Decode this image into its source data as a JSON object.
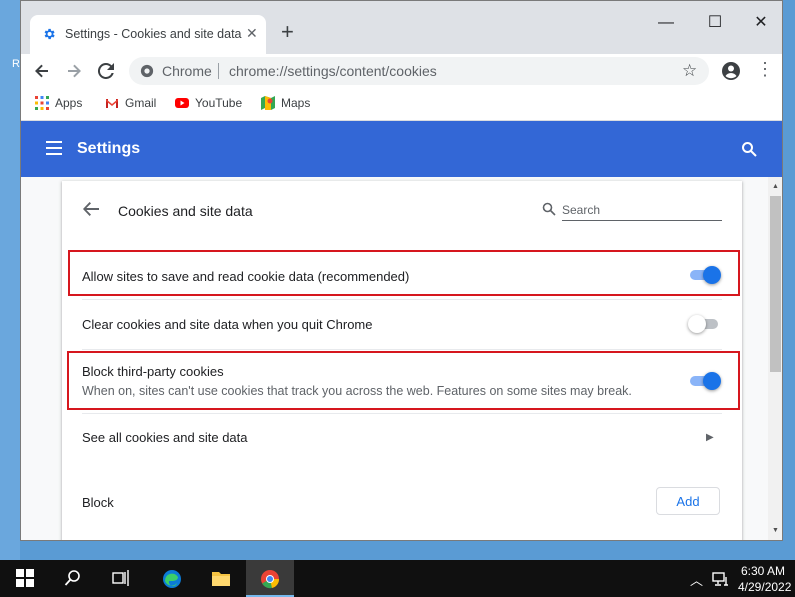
{
  "desktop": {
    "edge_letter": "R"
  },
  "browser": {
    "tab_title": "Settings - Cookies and site data",
    "tab_close": "✕",
    "new_tab": "+",
    "window_controls": {
      "minimize": "—",
      "maximize": "☐",
      "close": "✕"
    },
    "omnibox": {
      "scheme_label": "Chrome",
      "url": "chrome://settings/content/cookies"
    },
    "bookmarks": [
      {
        "label": "Apps",
        "icon": "apps-grid-icon"
      },
      {
        "label": "Gmail",
        "icon": "gmail-icon"
      },
      {
        "label": "YouTube",
        "icon": "youtube-icon"
      },
      {
        "label": "Maps",
        "icon": "maps-icon"
      }
    ]
  },
  "settings": {
    "header_title": "Settings",
    "page_title": "Cookies and site data",
    "search_placeholder": "Search",
    "rows": [
      {
        "label": "Allow sites to save and read cookie data (recommended)",
        "enabled": true,
        "highlighted": true
      },
      {
        "label": "Clear cookies and site data when you quit Chrome",
        "enabled": false,
        "highlighted": false
      },
      {
        "label": "Block third-party cookies",
        "sublabel": "When on, sites can't use cookies that track you across the web. Features on some sites may break.",
        "enabled": true,
        "highlighted": true
      },
      {
        "label": "See all cookies and site data"
      }
    ],
    "block_section": {
      "label": "Block",
      "add_button": "Add"
    },
    "colors": {
      "header": "#3367d6",
      "toggle_on": "#1a73e8",
      "highlight": "#d6171e"
    }
  },
  "taskbar": {
    "time": "6:30 AM",
    "date": "4/29/2022",
    "pinned": [
      "start-icon",
      "search-icon",
      "task-view-icon",
      "edge-icon",
      "file-explorer-icon",
      "chrome-icon"
    ]
  }
}
